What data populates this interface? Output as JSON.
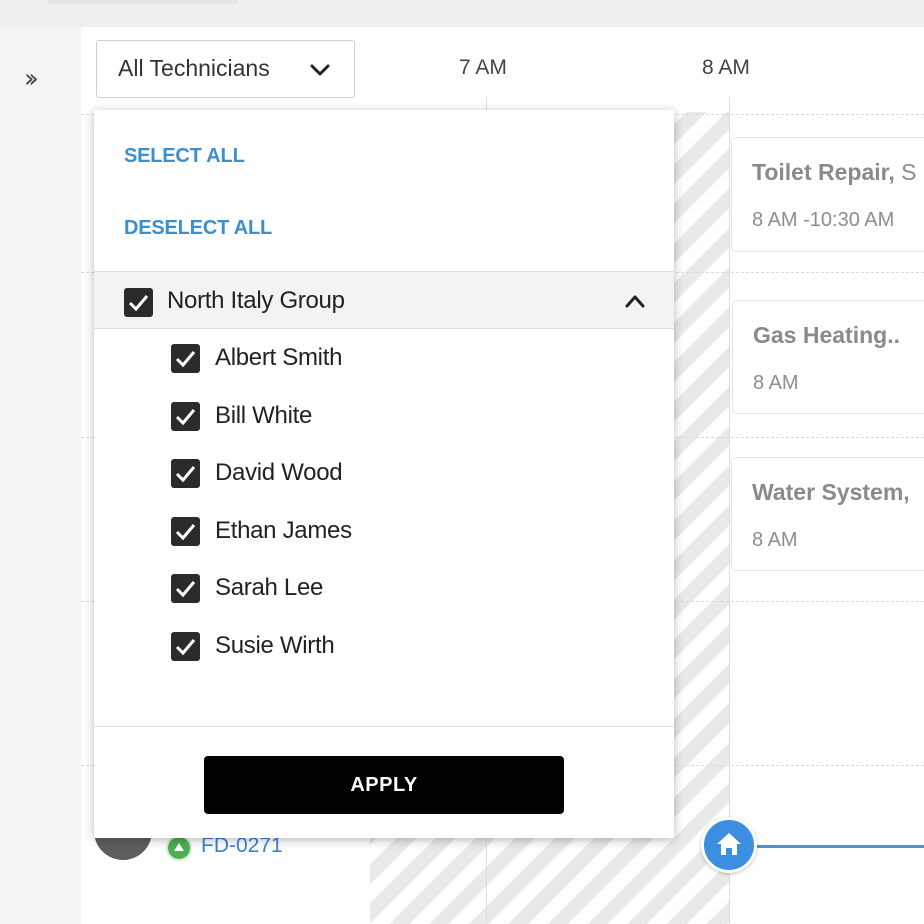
{
  "sidebar": {
    "expand_icon": "double-chevron-right-icon",
    "expand_text": "››"
  },
  "toolbar": {
    "filter_label": "All Technicians",
    "filter_icon": "chevron-down-icon"
  },
  "timeline": {
    "hours": [
      "7 AM",
      "8 AM"
    ]
  },
  "jobs": [
    {
      "title": "Toilet Repair,",
      "title_rest": " S",
      "time": "8 AM -10:30 AM"
    },
    {
      "title": "Gas Heating..",
      "title_rest": "",
      "time": "8 AM"
    },
    {
      "title": "Water System,",
      "title_rest": "",
      "time": "8 AM"
    }
  ],
  "technician_row": {
    "job_id": "FD-0271",
    "status_color": "#4caf50"
  },
  "home_pin": {
    "icon": "home-icon",
    "color": "#3b8ee0"
  },
  "dropdown": {
    "select_all": "SELECT ALL",
    "deselect_all": "DESELECT ALL",
    "group": {
      "label": "North Italy Group",
      "checked": true,
      "expanded": true
    },
    "technicians": [
      {
        "name": "Albert Smith",
        "checked": true
      },
      {
        "name": "Bill White",
        "checked": true
      },
      {
        "name": "David Wood",
        "checked": true
      },
      {
        "name": "Ethan James",
        "checked": true
      },
      {
        "name": "Sarah Lee",
        "checked": true
      },
      {
        "name": "Susie Wirth",
        "checked": true
      }
    ],
    "apply_label": "APPLY"
  },
  "colors": {
    "link": "#3a8fcf",
    "apply_bg": "#000000",
    "checkbox": "#2b2b2b",
    "job_id": "#3d7fd2"
  }
}
